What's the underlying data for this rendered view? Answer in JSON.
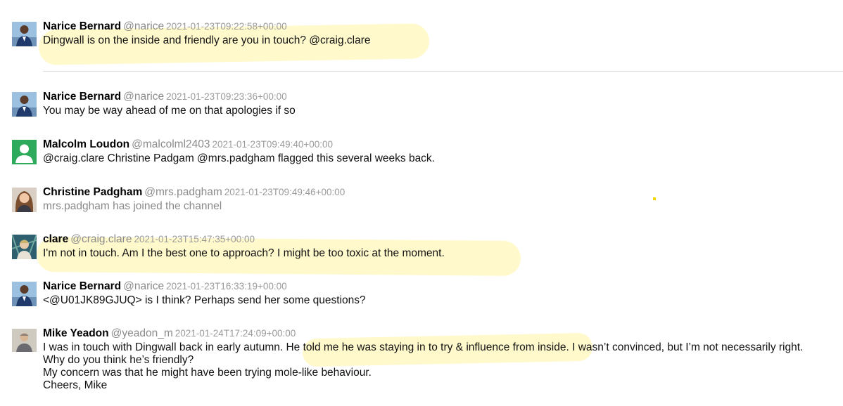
{
  "messages": [
    {
      "name": "Narice Bernard",
      "handle": "@narice",
      "timestamp": "2021-01-23T09:22:58+00:00",
      "avatar": "narice-avatar",
      "lines": [
        "Dingwall is on the inside and friendly are you in touch? @craig.clare"
      ],
      "highlighted": true
    },
    {
      "name": "Narice Bernard",
      "handle": "@narice",
      "timestamp": "2021-01-23T09:23:36+00:00",
      "avatar": "narice-avatar",
      "lines": [
        "You may be way ahead of me on that apologies if so"
      ]
    },
    {
      "name": "Malcolm Loudon",
      "handle": "@malcolml2403",
      "timestamp": "2021-01-23T09:49:40+00:00",
      "avatar": "default-user-avatar",
      "lines": [
        "@craig.clare Christine Padgam @mrs.padgham flagged this several weeks back."
      ]
    },
    {
      "name": "Christine Padgham",
      "handle": "@mrs.padgham",
      "timestamp": "2021-01-23T09:49:46+00:00",
      "avatar": "christine-avatar",
      "lines": [
        "mrs.padgham has joined the channel"
      ],
      "muted": true
    },
    {
      "name": "clare",
      "handle": "@craig.clare",
      "timestamp": "2021-01-23T15:47:35+00:00",
      "avatar": "clare-avatar",
      "lines": [
        "I'm not in touch. Am I the best one to approach? I might be too toxic at the moment."
      ],
      "highlighted": true
    },
    {
      "name": "Narice Bernard",
      "handle": "@narice",
      "timestamp": "2021-01-23T16:33:19+00:00",
      "avatar": "narice-avatar",
      "lines": [
        "<@U01JK89GJUQ> is I think? Perhaps send her some questions?"
      ]
    },
    {
      "name": "Mike Yeadon",
      "handle": "@yeadon_m",
      "timestamp": "2021-01-24T17:24:09+00:00",
      "avatar": "mike-avatar",
      "lines": [
        "I was in touch with Dingwall back in early autumn. He told me he was staying in to try & influence from inside. I wasn’t convinced, but I’m not necessarily right.",
        "Why do you think he’s friendly?",
        "My concern was that he might have been trying mole-like behaviour.",
        "Cheers, Mike"
      ],
      "highlighted": true
    }
  ],
  "colors": {
    "highlight": "#fff9c9",
    "timestamp": "#9a9a9a",
    "handle": "#8a8a8a",
    "divider": "#dcdcdc",
    "default_avatar": "#2eaa5c"
  }
}
